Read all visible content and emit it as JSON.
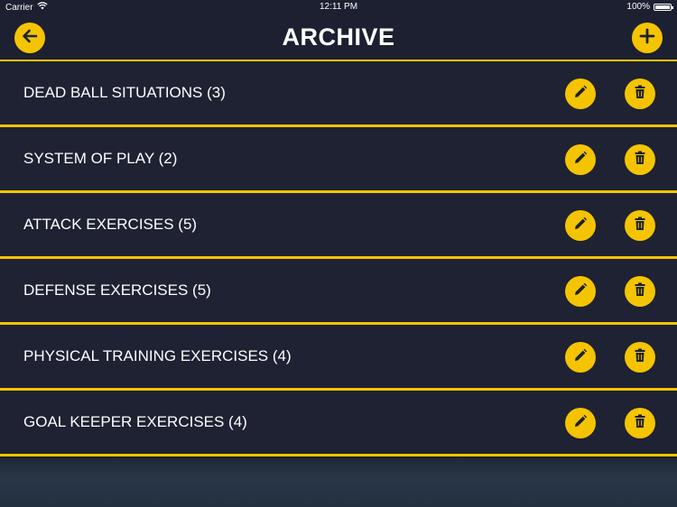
{
  "status_bar": {
    "carrier": "Carrier",
    "time": "12:11 PM",
    "battery": "100%",
    "battery_level": 1.0
  },
  "header": {
    "title": "ARCHIVE",
    "back_icon": "arrow-left-icon",
    "add_icon": "plus-icon"
  },
  "colors": {
    "accent": "#f5c400",
    "background": "#1e2232",
    "text": "#ffffff"
  },
  "rows": [
    {
      "label": "DEAD BALL SITUATIONS (3)",
      "edit_icon": "pencil-icon",
      "delete_icon": "trash-icon"
    },
    {
      "label": "SYSTEM OF PLAY (2)",
      "edit_icon": "pencil-icon",
      "delete_icon": "trash-icon"
    },
    {
      "label": "ATTACK EXERCISES (5)",
      "edit_icon": "pencil-icon",
      "delete_icon": "trash-icon"
    },
    {
      "label": "DEFENSE EXERCISES (5)",
      "edit_icon": "pencil-icon",
      "delete_icon": "trash-icon"
    },
    {
      "label": "PHYSICAL TRAINING EXERCISES (4)",
      "edit_icon": "pencil-icon",
      "delete_icon": "trash-icon"
    },
    {
      "label": "GOAL KEEPER EXERCISES (4)",
      "edit_icon": "pencil-icon",
      "delete_icon": "trash-icon"
    }
  ]
}
